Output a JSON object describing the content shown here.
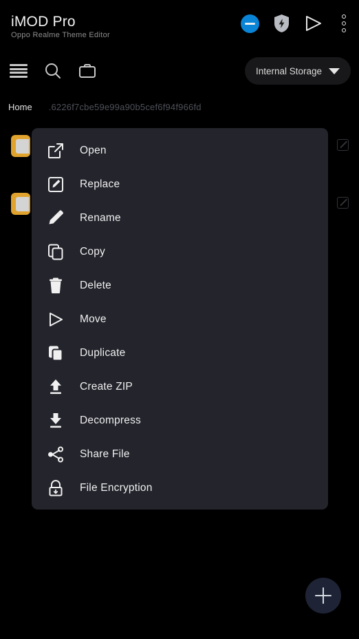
{
  "header": {
    "title": "iMOD Pro",
    "subtitle": "Oppo Realme Theme Editor",
    "icons": [
      {
        "name": "minus-circle-icon",
        "label": "minus-circle",
        "color": "#0a84d6"
      },
      {
        "name": "shield-bolt-icon",
        "label": "shield-bolt",
        "color": "#b9bcc2"
      },
      {
        "name": "play-icon",
        "label": "play",
        "color": "#e8e8e8"
      },
      {
        "name": "overflow-menu-icon",
        "label": "kebab-menu",
        "color": "#e8e8e8"
      }
    ]
  },
  "toolbar": {
    "icons": [
      {
        "name": "list-menu-icon",
        "label": "list-menu"
      },
      {
        "name": "search-icon",
        "label": "search"
      },
      {
        "name": "briefcase-icon",
        "label": "briefcase"
      }
    ],
    "storage_selector": {
      "label": "Internal Storage",
      "caret": "chevron-down-icon"
    }
  },
  "breadcrumb": {
    "home": "Home",
    "path": ".6226f7cbe59e99a90b5cef6f94f966fd"
  },
  "file_rows": [
    {
      "icon": "folder-icon",
      "action_icon": "edit-icon"
    },
    {
      "icon": "folder-icon",
      "action_icon": "edit-icon"
    }
  ],
  "context_menu": {
    "items": [
      {
        "label": "Open",
        "icon": "open-external-icon"
      },
      {
        "label": "Replace",
        "icon": "replace-icon"
      },
      {
        "label": "Rename",
        "icon": "pencil-icon"
      },
      {
        "label": "Copy",
        "icon": "copy-icon"
      },
      {
        "label": "Delete",
        "icon": "trash-icon"
      },
      {
        "label": "Move",
        "icon": "move-play-icon"
      },
      {
        "label": "Duplicate",
        "icon": "duplicate-icon"
      },
      {
        "label": "Create ZIP",
        "icon": "upload-arrow-icon"
      },
      {
        "label": "Decompress",
        "icon": "download-arrow-icon"
      },
      {
        "label": "Share File",
        "icon": "share-nodes-icon"
      },
      {
        "label": "File Encryption",
        "icon": "lock-icon"
      }
    ]
  },
  "fab": {
    "label": "+",
    "name": "add-button",
    "color": "#1e2436"
  },
  "colors": {
    "background": "#000000",
    "menu_background": "#23242c",
    "accent_blue": "#0a84d6",
    "folder_gold": "#e0a32e",
    "pill_background": "#18181a"
  }
}
